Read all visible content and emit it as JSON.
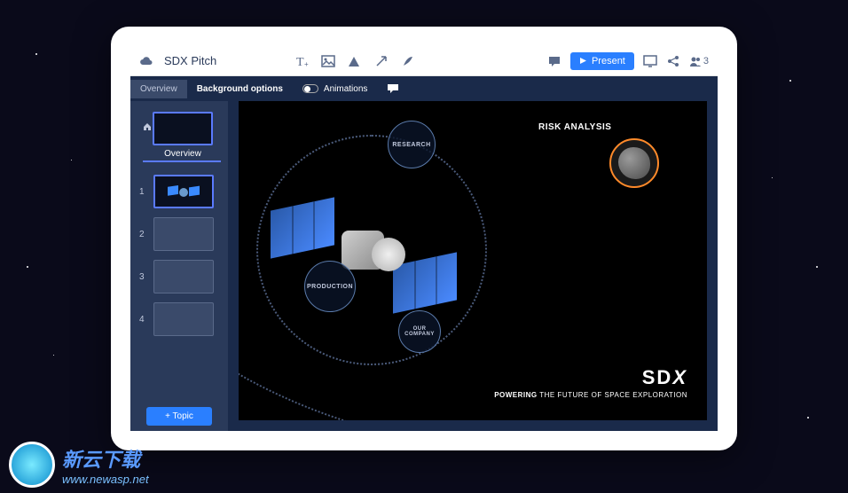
{
  "app_title": "SDX Pitch",
  "present_label": "Present",
  "people_count": "3",
  "sidebar_tab": "Overview",
  "toolbar_tabs": {
    "background": "Background options",
    "animations": "Animations"
  },
  "overview_label": "Overview",
  "slides": [
    "1",
    "2",
    "3",
    "4"
  ],
  "add_topic_label": "+ Topic",
  "canvas": {
    "nodes": {
      "research": "RESEARCH",
      "production": "PRODUCTION",
      "our_company": "OUR COMPANY"
    },
    "risk_label": "RISK ANALYSIS",
    "brand_logo": "SD",
    "brand_logo_x": "X",
    "brand_tag_strong": "POWERING",
    "brand_tag_rest": " THE FUTURE OF SPACE EXPLORATION"
  },
  "watermark": {
    "cn": "新云下载",
    "url": "www.newasp.net"
  }
}
